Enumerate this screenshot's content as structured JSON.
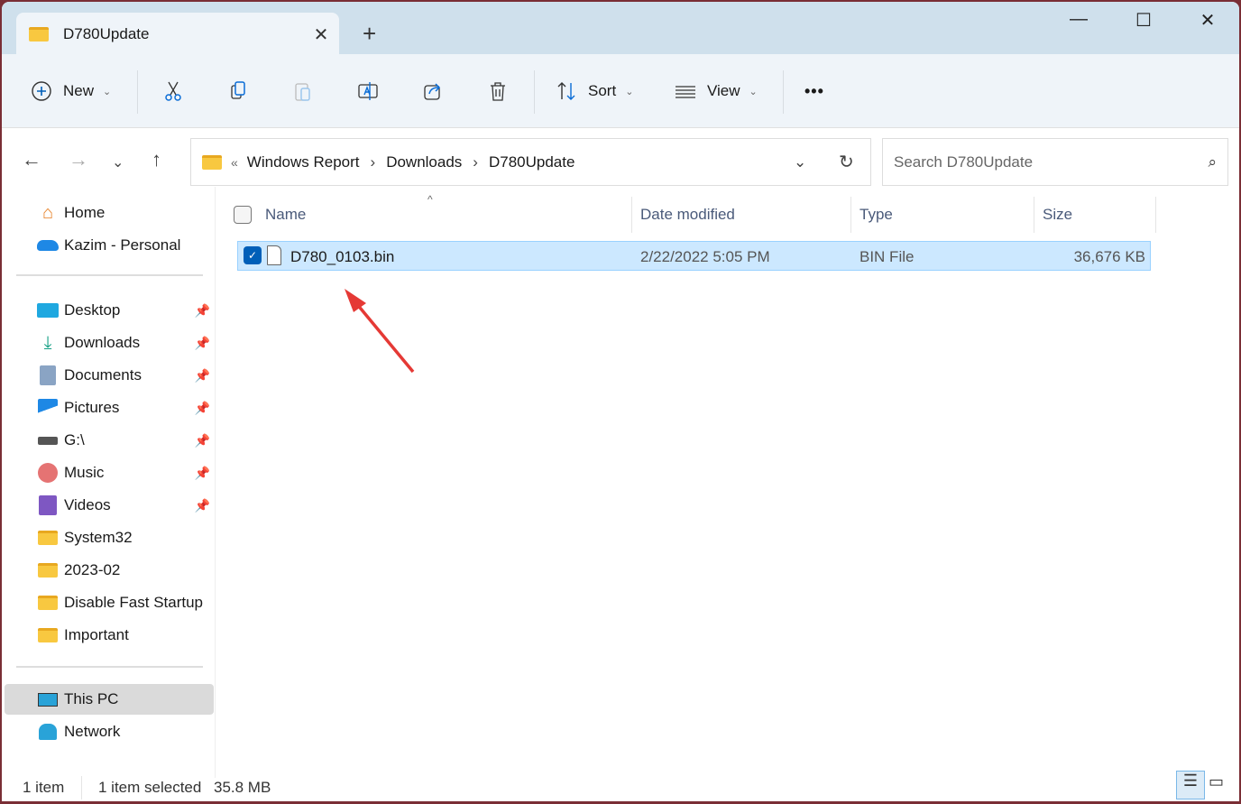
{
  "window": {
    "tab_title": "D780Update",
    "new_tab": "+",
    "minimize": "—",
    "maximize": "☐",
    "close": "✕"
  },
  "toolbar": {
    "new_label": "New",
    "sort_label": "Sort",
    "view_label": "View",
    "more": "•••",
    "icons": [
      "cut-icon",
      "copy-icon",
      "paste-icon",
      "rename-icon",
      "share-icon",
      "delete-icon"
    ]
  },
  "address": {
    "overflow": "«",
    "crumbs": [
      "Windows Report",
      "Downloads",
      "D780Update"
    ],
    "separator": "›"
  },
  "search": {
    "placeholder": "Search D780Update"
  },
  "sidebar": {
    "top": [
      {
        "label": "Home"
      },
      {
        "label": "Kazim - Personal"
      }
    ],
    "quick": [
      {
        "label": "Desktop",
        "pinned": true
      },
      {
        "label": "Downloads",
        "pinned": true
      },
      {
        "label": "Documents",
        "pinned": true
      },
      {
        "label": "Pictures",
        "pinned": true
      },
      {
        "label": "G:\\",
        "pinned": true
      },
      {
        "label": "Music",
        "pinned": true
      },
      {
        "label": "Videos",
        "pinned": true
      },
      {
        "label": "System32"
      },
      {
        "label": "2023-02"
      },
      {
        "label": "Disable Fast Startup"
      },
      {
        "label": "Important"
      }
    ],
    "bottom": [
      {
        "label": "This PC",
        "selected": true
      },
      {
        "label": "Network"
      }
    ]
  },
  "columns": {
    "name": "Name",
    "date": "Date modified",
    "type": "Type",
    "size": "Size"
  },
  "files": [
    {
      "name": "D780_0103.bin",
      "date": "2/22/2022 5:05 PM",
      "type": "BIN File",
      "size": "36,676 KB",
      "selected": true
    }
  ],
  "status": {
    "count": "1 item",
    "selected": "1 item selected",
    "size": "35.8 MB"
  },
  "colors": {
    "accent": "#005fb8",
    "selection": "#cce8ff",
    "annotation_arrow": "#e53935"
  }
}
